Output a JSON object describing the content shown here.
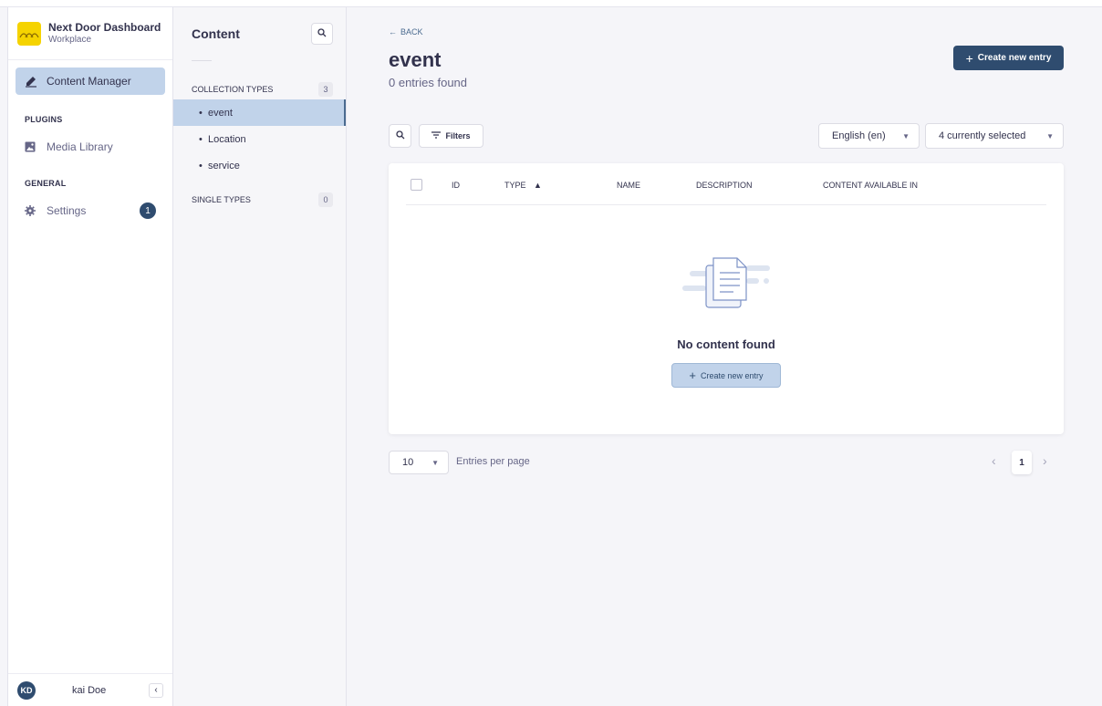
{
  "brand": {
    "name": "Next Door Dashboard",
    "workspace": "Workplace",
    "logo_color": "#f5d300"
  },
  "mainnav": {
    "active_item": "Content Manager",
    "sections": {
      "plugins": "PLUGINS",
      "general": "GENERAL"
    },
    "plugins_items": [
      {
        "label": "Media Library",
        "icon": "image-icon"
      }
    ],
    "general_items": [
      {
        "label": "Settings",
        "icon": "gear-icon",
        "badge": "1"
      }
    ]
  },
  "user": {
    "initials": "KD",
    "name": "kai Doe"
  },
  "subnav": {
    "title": "Content",
    "collection_types": {
      "label": "COLLECTION TYPES",
      "count": "3",
      "items": [
        "event",
        "Location",
        "service"
      ]
    },
    "single_types": {
      "label": "SINGLE TYPES",
      "count": "0"
    }
  },
  "content": {
    "back_label": "BACK",
    "title": "event",
    "entries_text": "0 entries found",
    "create_button": "Create new entry",
    "filters_label": "Filters",
    "locale_select": "English (en)",
    "columns_select": "4 currently selected",
    "table_headers": [
      "ID",
      "TYPE",
      "NAME",
      "DESCRIPTION",
      "CONTENT AVAILABLE IN"
    ],
    "empty_text": "No content found",
    "empty_create_button": "Create new entry",
    "per_page_value": "10",
    "per_page_label": "Entries per page",
    "current_page": "1"
  },
  "colors": {
    "accent": "#2f4c6f",
    "active_bg": "#c1d3ea",
    "page_bg": "#f5f5f9"
  }
}
